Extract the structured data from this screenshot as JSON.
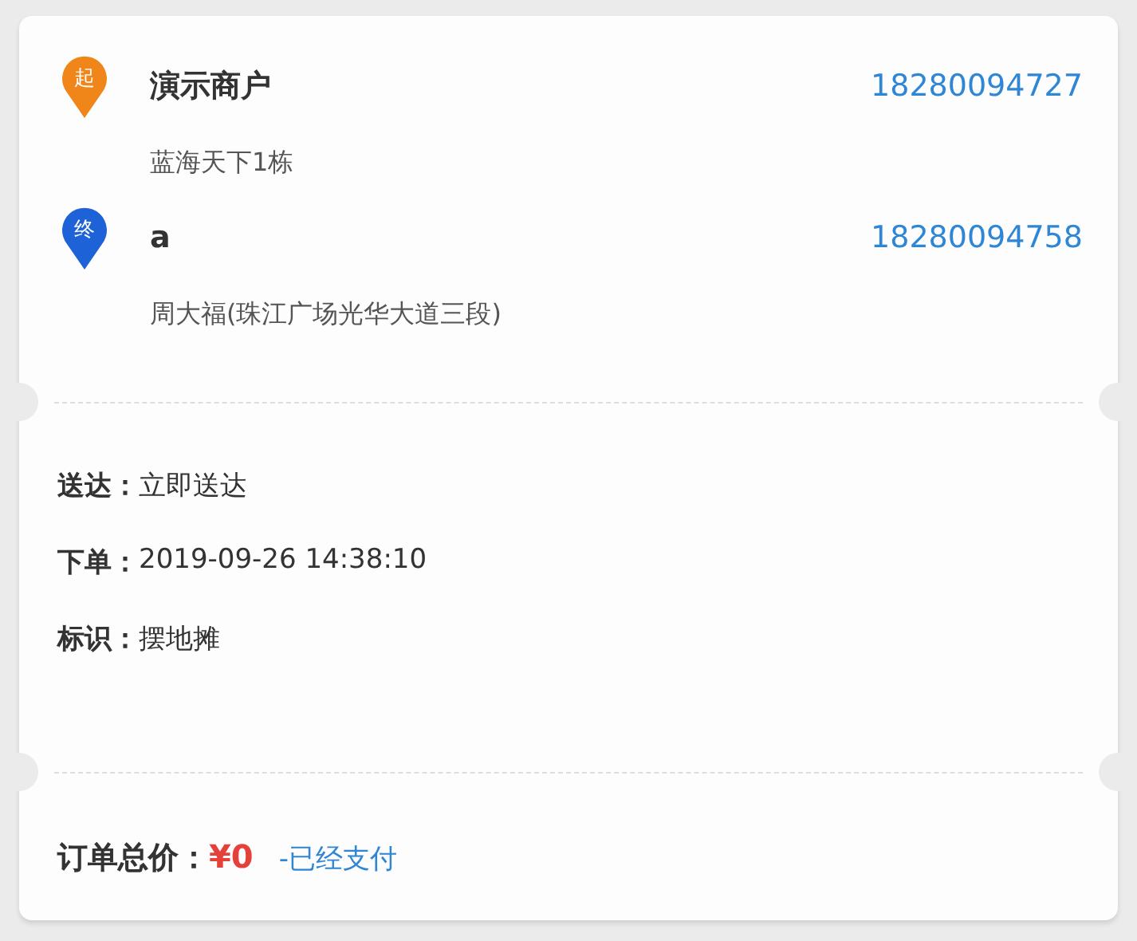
{
  "stops": [
    {
      "badge": "起",
      "color": "#f0861a",
      "name": "演示商户",
      "phone": "18280094727",
      "address": "蓝海天下1栋"
    },
    {
      "badge": "终",
      "color": "#1d62d6",
      "name": "a",
      "phone": "18280094758",
      "address": "周大福(珠江广场光华大道三段)"
    }
  ],
  "details": [
    {
      "label": "送达：",
      "value": "立即送达"
    },
    {
      "label": "下单：",
      "value": "2019-09-26 14:38:10"
    },
    {
      "label": "标识：",
      "value": "摆地摊"
    }
  ],
  "total": {
    "label": "订单总价：",
    "amount": "¥0",
    "status": "-已经支付"
  }
}
